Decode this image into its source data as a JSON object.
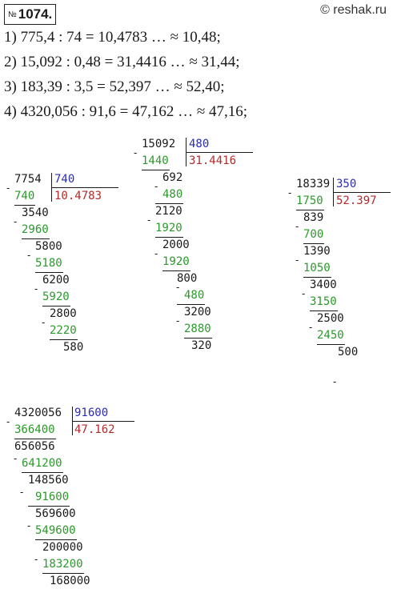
{
  "header": {
    "number_sign": "№",
    "number": "1074.",
    "site": "© reshak.ru"
  },
  "equations": [
    "1) 775,4 : 74 = 10,4783 … ≈ 10,48;",
    "2) 15,092 : 0,48 = 31,4416 … ≈ 31,44;",
    "3) 183,39 : 3,5 = 52,397 … ≈ 52,40;",
    "4) 4320,056 : 91,6 = 47,162 … ≈ 47,16;"
  ],
  "divisions": [
    {
      "dividend": "7754",
      "divisor": "740",
      "quotient": "10.4783",
      "steps": [
        {
          "sub": "740",
          "rem": "3540"
        },
        {
          "sub": "2960",
          "rem": "5800"
        },
        {
          "sub": "5180",
          "rem": "6200"
        },
        {
          "sub": "5920",
          "rem": "2800"
        },
        {
          "sub": "2220",
          "rem": "580"
        }
      ]
    },
    {
      "dividend": "15092",
      "divisor": "480",
      "quotient": "31.4416",
      "steps": [
        {
          "sub": "1440",
          "rem": "692"
        },
        {
          "sub": "480",
          "rem": "2120"
        },
        {
          "sub": "1920",
          "rem": "2000"
        },
        {
          "sub": "1920",
          "rem": "800"
        },
        {
          "sub": "480",
          "rem": "3200"
        },
        {
          "sub": "2880",
          "rem": "320"
        }
      ]
    },
    {
      "dividend": "18339",
      "divisor": "350",
      "quotient": "52.397",
      "steps": [
        {
          "sub": "1750",
          "rem": "839"
        },
        {
          "sub": "700",
          "rem": "1390"
        },
        {
          "sub": "1050",
          "rem": "3400"
        },
        {
          "sub": "3150",
          "rem": "2500"
        },
        {
          "sub": "2450",
          "rem": "500"
        }
      ]
    },
    {
      "dividend": "4320056",
      "divisor": "91600",
      "quotient": "47.162",
      "steps": [
        {
          "sub": "366400",
          "rem": "656056"
        },
        {
          "sub": "641200",
          "rem": "148560"
        },
        {
          "sub": "91600",
          "rem": "569600"
        },
        {
          "sub": "549600",
          "rem": "200000"
        },
        {
          "sub": "183200",
          "rem": "168000"
        }
      ]
    }
  ],
  "colors": {
    "subtrahend": "#2a9a2a",
    "divisor": "#2b2bb8",
    "quotient": "#b32b2b",
    "text": "#1a1a1a"
  }
}
